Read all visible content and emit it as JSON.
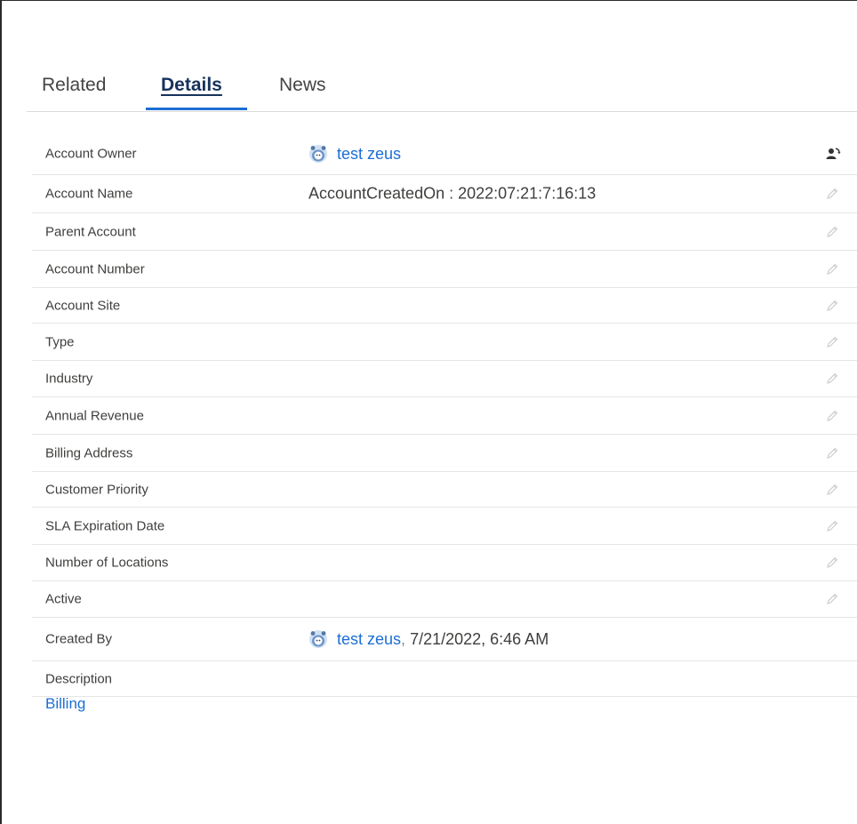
{
  "tabs": [
    {
      "label": "Related"
    },
    {
      "label": "Details"
    },
    {
      "label": "News"
    }
  ],
  "fields": {
    "account_owner": {
      "label": "Account Owner",
      "value": "test zeus"
    },
    "account_name": {
      "label": "Account Name",
      "value": "AccountCreatedOn : 2022:07:21:7:16:13"
    },
    "parent_account": {
      "label": "Parent Account"
    },
    "account_number": {
      "label": "Account Number"
    },
    "account_site": {
      "label": "Account Site"
    },
    "type": {
      "label": "Type"
    },
    "industry": {
      "label": "Industry"
    },
    "annual_revenue": {
      "label": "Annual Revenue"
    },
    "billing_address": {
      "label": "Billing Address"
    },
    "customer_priority": {
      "label": "Customer Priority"
    },
    "sla_expiration_date": {
      "label": "SLA Expiration Date"
    },
    "number_of_locations": {
      "label": "Number of Locations"
    },
    "active": {
      "label": "Active"
    },
    "created_by": {
      "label": "Created By",
      "user": "test zeus",
      "separator": ",",
      "timestamp": " 7/21/2022, 6:46 AM"
    },
    "description": {
      "label": "Description"
    }
  },
  "sections": {
    "billing": "Billing"
  },
  "icons": {
    "avatar": "avatar-icon",
    "edit": "pencil-icon",
    "change_owner": "change-owner-icon"
  },
  "colors": {
    "link": "#1b6ed6",
    "tab_active_underline": "#1b6ed6"
  }
}
